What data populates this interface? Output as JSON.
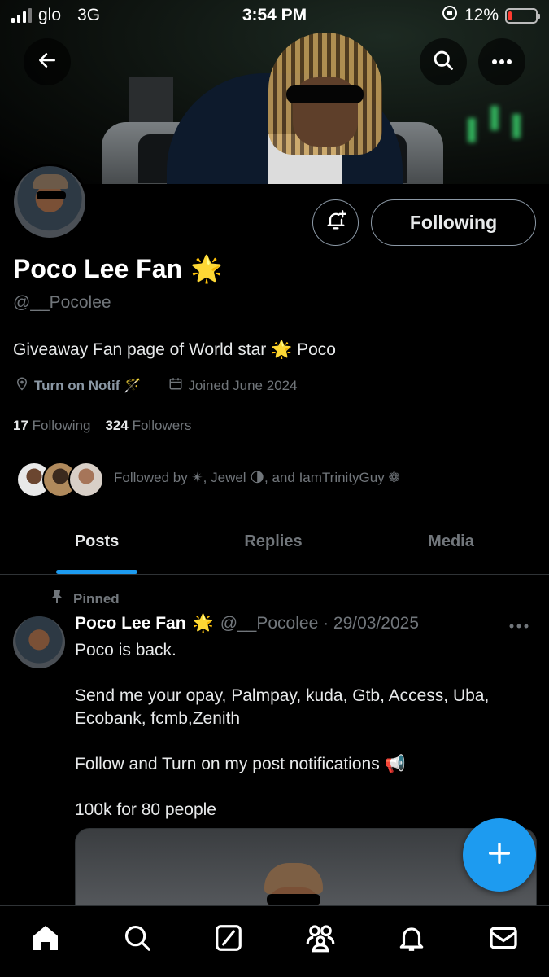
{
  "status_bar": {
    "carrier": "glo",
    "network": "3G",
    "time": "3:54 PM",
    "battery_percent": "12%",
    "battery_level": 0.12,
    "signal_bars_active": 3,
    "battery_color": "#ff3b30"
  },
  "profile": {
    "display_name": "Poco Lee Fan",
    "badge_emoji": "🌟",
    "handle": "@__Pocolee",
    "bio": "Giveaway Fan page of World star 🌟 Poco",
    "location": "Turn on Notif 🪄",
    "joined": "Joined June 2024",
    "following_count": "17",
    "following_label": "Following",
    "followers_count": "324",
    "followers_label": "Followers",
    "followed_by": "Followed by ✴︎, Jewel 🌗, and IamTrinityGuy ❁",
    "follow_button_label": "Following"
  },
  "tabs": [
    {
      "label": "Posts",
      "active": true
    },
    {
      "label": "Replies",
      "active": false
    },
    {
      "label": "Media",
      "active": false
    }
  ],
  "pinned_post": {
    "pinned_label": "Pinned",
    "author_name": "Poco Lee Fan",
    "author_badge": "🌟",
    "author_handle_date": "@__Pocolee · 29/03/2025",
    "text": "Poco is back.\n\nSend me your opay, Palmpay, kuda, Gtb, Access, Uba, Ecobank, fcmb,Zenith\n\nFollow and Turn on my post notifications 📢\n\n100k for 80 people"
  },
  "icons": {
    "back": "arrow-left-icon",
    "search": "search-icon",
    "more": "more-icon",
    "bell_plus": "bell-plus-icon",
    "compose": "plus-icon"
  },
  "bottom_nav": [
    "home-icon",
    "search-icon",
    "grok-icon",
    "communities-icon",
    "notifications-icon",
    "messages-icon"
  ],
  "colors": {
    "accent": "#1d9bf0",
    "background": "#000000",
    "secondary_text": "#71767b"
  }
}
